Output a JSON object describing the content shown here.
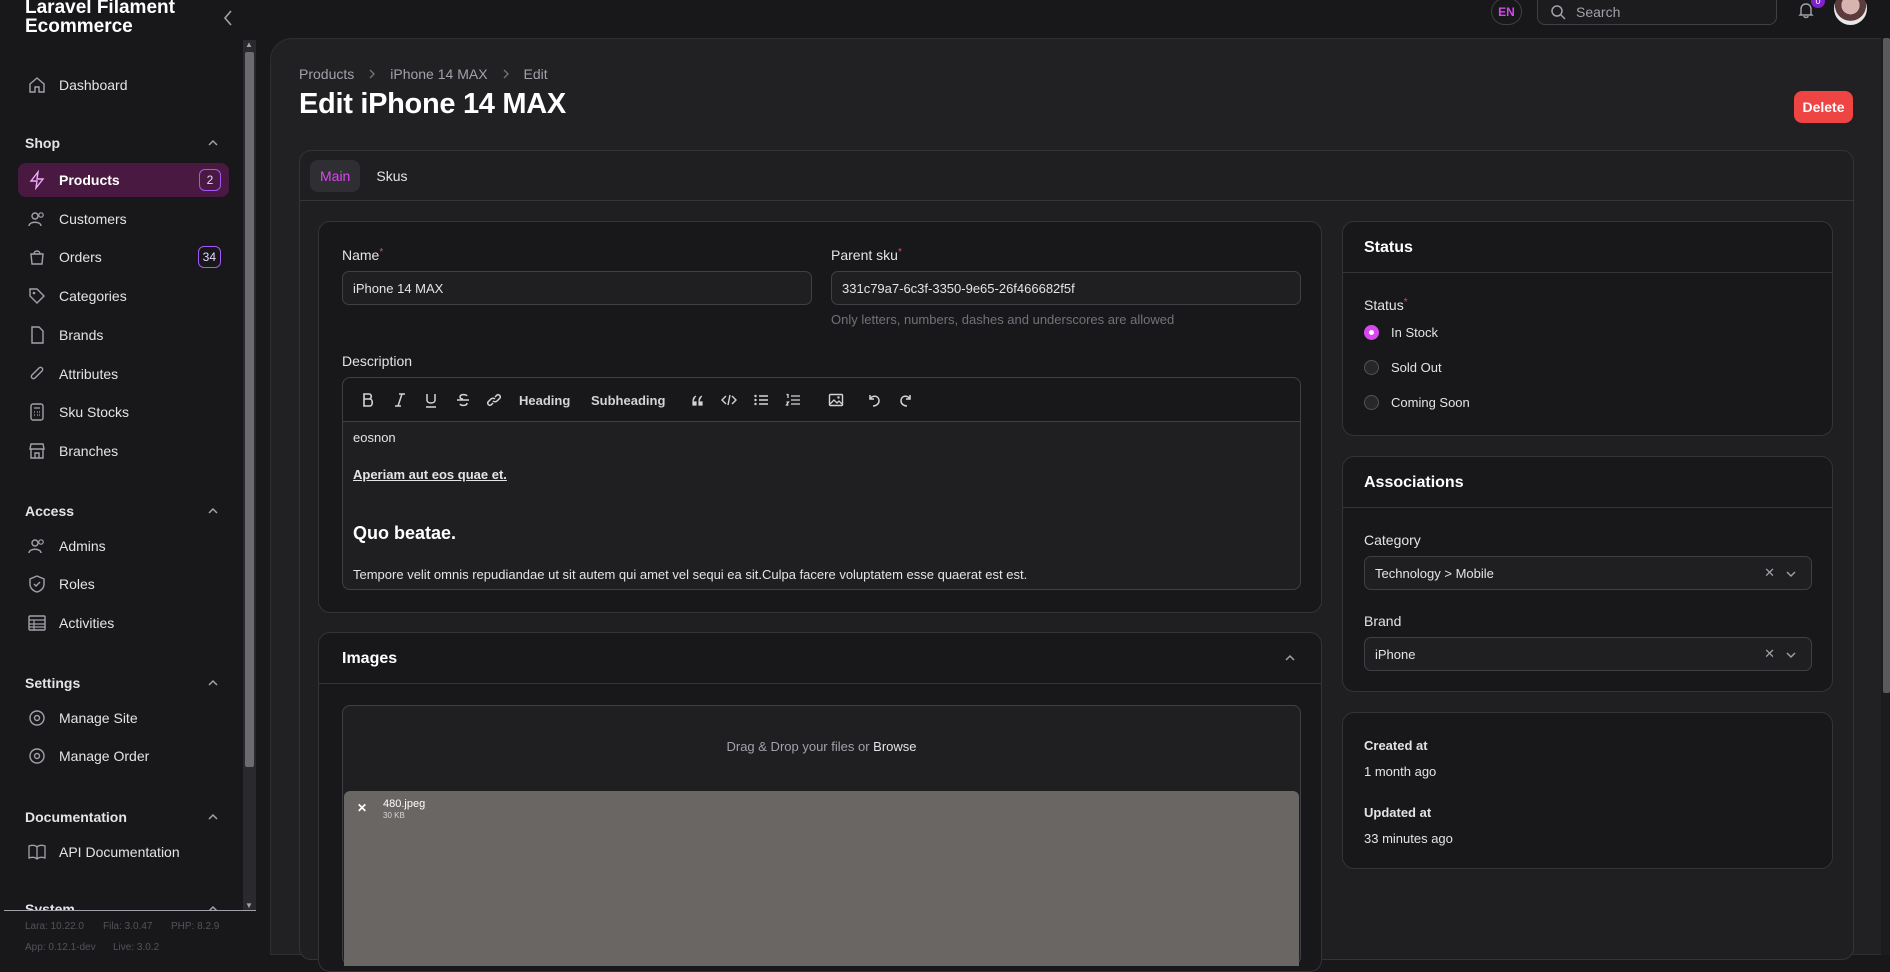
{
  "app": {
    "brand": "Laravel Filament Ecommerce"
  },
  "topbar": {
    "lang": "EN",
    "search_placeholder": "Search",
    "notifications_count": "0"
  },
  "nav": {
    "dashboard": "Dashboard",
    "shop": {
      "title": "Shop",
      "products": "Products",
      "products_badge": "2",
      "customers": "Customers",
      "orders": "Orders",
      "orders_badge": "34",
      "categories": "Categories",
      "brands": "Brands",
      "attributes": "Attributes",
      "sku_stocks": "Sku Stocks",
      "branches": "Branches"
    },
    "access": {
      "title": "Access",
      "admins": "Admins",
      "roles": "Roles",
      "activities": "Activities"
    },
    "settings": {
      "title": "Settings",
      "manage_site": "Manage Site",
      "manage_order": "Manage Order"
    },
    "documentation": {
      "title": "Documentation",
      "api": "API Documentation"
    },
    "system": {
      "title": "System"
    }
  },
  "footer": {
    "lara": "Lara: 10.22.0",
    "fila": "Fila: 3.0.47",
    "php": "PHP: 8.2.9",
    "app": "App: 0.12.1-dev",
    "live": "Live: 3.0.2"
  },
  "page": {
    "breadcrumb": [
      "Products",
      "iPhone 14 MAX",
      "Edit"
    ],
    "title": "Edit iPhone 14 MAX",
    "delete": "Delete",
    "tabs": [
      "Main",
      "Skus"
    ]
  },
  "form": {
    "name_label": "Name",
    "name_value": "iPhone 14 MAX",
    "sku_label": "Parent sku",
    "sku_value": "331c79a7-6c3f-3350-9e65-26f466682f5f",
    "sku_hint": "Only letters, numbers, dashes and underscores are allowed",
    "description_label": "Description",
    "toolbar": {
      "heading": "Heading",
      "subheading": "Subheading"
    },
    "description": {
      "p1": "eosnon",
      "link": "Aperiam aut eos quae et.",
      "h": "Quo beatae.",
      "p2": "Tempore velit omnis repudiandae ut sit autem qui amet vel sequi ea sit.Culpa facere voluptatem esse quaerat est est."
    }
  },
  "images": {
    "title": "Images",
    "drop_prefix": "Drag & Drop your files or ",
    "browse": "Browse",
    "file_name": "480.jpeg",
    "file_size": "30 KB"
  },
  "status": {
    "title": "Status",
    "label": "Status",
    "options": [
      "In Stock",
      "Sold Out",
      "Coming Soon"
    ],
    "selected": "In Stock"
  },
  "associations": {
    "title": "Associations",
    "category_label": "Category",
    "category_value": "Technology > Mobile",
    "brand_label": "Brand",
    "brand_value": "iPhone"
  },
  "meta": {
    "created_label": "Created at",
    "created_value": "1 month ago",
    "updated_label": "Updated at",
    "updated_value": "33 minutes ago"
  },
  "colors": {
    "accent": "#d946ef",
    "danger": "#ef4444",
    "bg": "#18181b"
  }
}
